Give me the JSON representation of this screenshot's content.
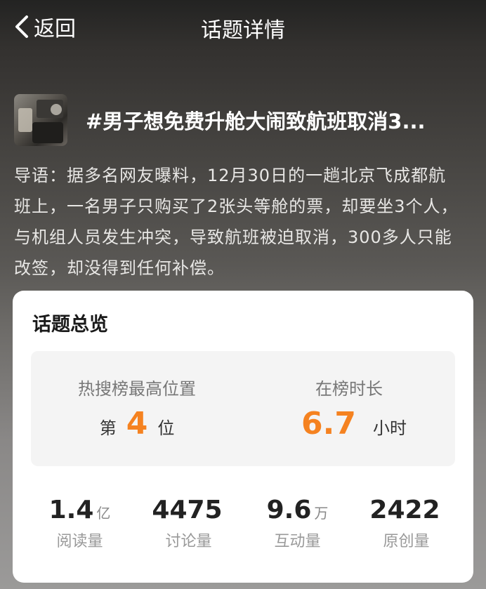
{
  "nav": {
    "back_label": "返回",
    "title": "话题详情"
  },
  "topic": {
    "title": "#男子想免费升舱大闹致航班取消3...",
    "intro": "导语：据多名网友曝料，12月30日的一趟北京飞成都航班上，一名男子只购买了2张头等舱的票，却要坐3个人，与机组人员发生冲突，导致航班被迫取消，300多人只能改签，却没得到任何补偿。"
  },
  "overview": {
    "heading": "话题总览",
    "rank": {
      "label": "热搜榜最高位置",
      "prefix": "第",
      "value": "4",
      "suffix": "位"
    },
    "duration": {
      "label": "在榜时长",
      "value": "6.7",
      "unit": "小时"
    }
  },
  "stats": [
    {
      "value": "1.4",
      "unit": "亿",
      "label": "阅读量"
    },
    {
      "value": "4475",
      "unit": "",
      "label": "讨论量"
    },
    {
      "value": "9.6",
      "unit": "万",
      "label": "互动量"
    },
    {
      "value": "2422",
      "unit": "",
      "label": "原创量"
    }
  ],
  "colors": {
    "accent": "#f58220",
    "card_bg": "#ffffff",
    "panel_bg": "#f4f4f4"
  },
  "icons": {
    "back": "chevron-left-icon"
  }
}
